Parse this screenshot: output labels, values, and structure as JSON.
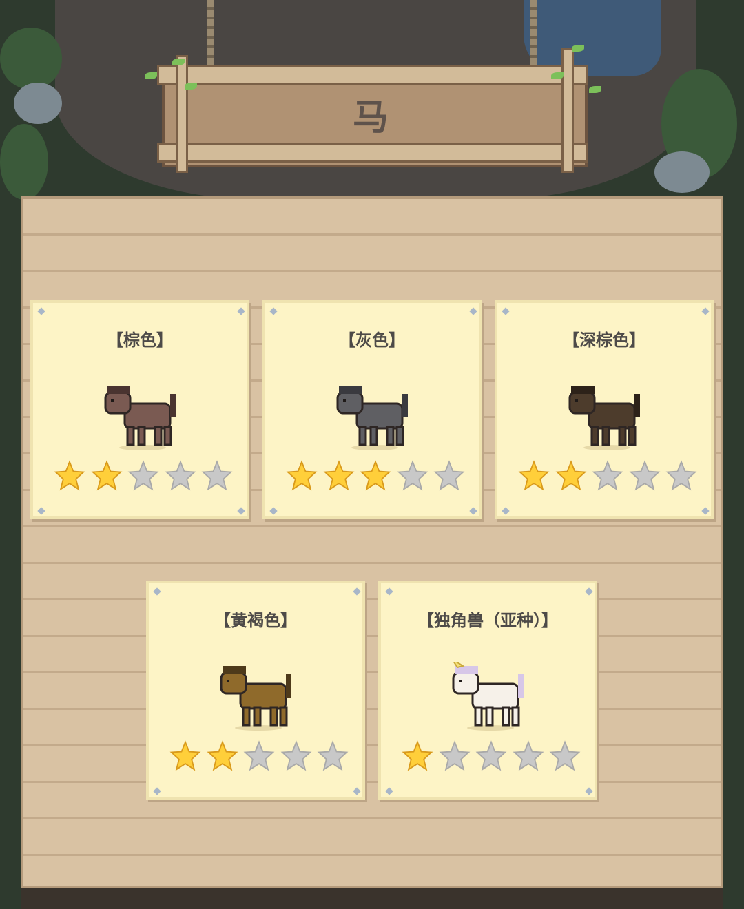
{
  "sign": {
    "title": "马"
  },
  "cards": [
    {
      "name": "【棕色】",
      "rating": 2,
      "coat": "#7a5a52",
      "mane": "#4a3430"
    },
    {
      "name": "【灰色】",
      "rating": 3,
      "coat": "#5f5f63",
      "mane": "#3a3a3f"
    },
    {
      "name": "【深棕色】",
      "rating": 2,
      "coat": "#4d3c2c",
      "mane": "#2d2219"
    },
    {
      "name": "【黄褐色】",
      "rating": 2,
      "coat": "#8f6a2b",
      "mane": "#4e3a1a"
    },
    {
      "name": "【独角兽（亚种）】",
      "rating": 1,
      "coat": "#f6f1e9",
      "mane": "#d7c7e8"
    }
  ],
  "star_max": 5,
  "colors": {
    "star_on": "#ffcf3a",
    "star_off": "#c8c8c8",
    "card_bg": "#fdf4c6",
    "panel": "#d9c2a3"
  }
}
